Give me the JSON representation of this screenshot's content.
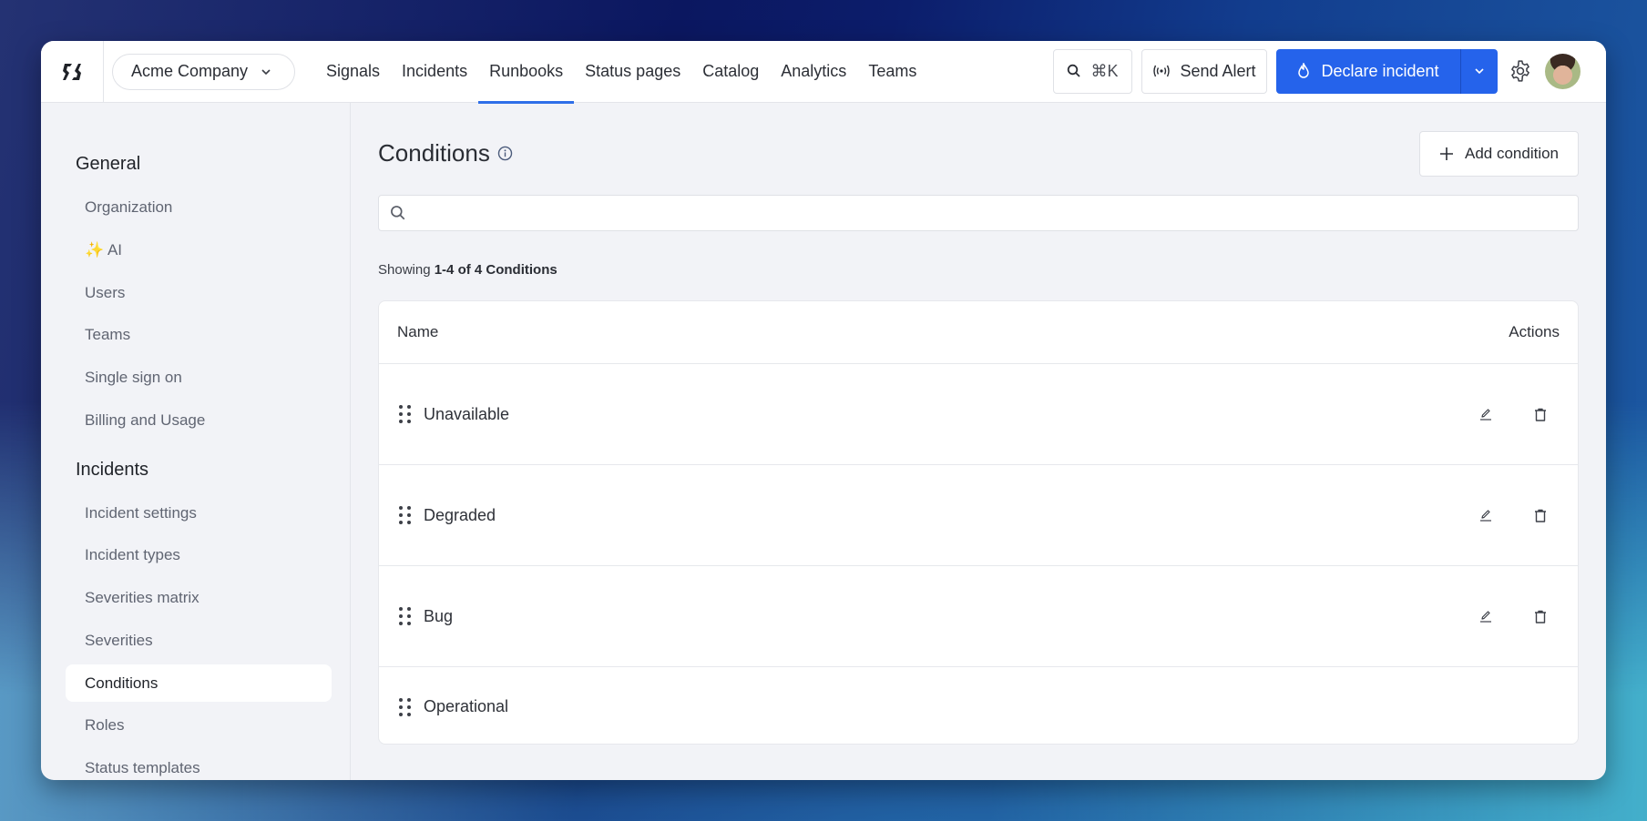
{
  "topbar": {
    "logo": "firehydrant-logo-icon",
    "org_name": "Acme Company",
    "nav": [
      {
        "label": "Signals",
        "active": false
      },
      {
        "label": "Incidents",
        "active": false
      },
      {
        "label": "Runbooks",
        "active": true
      },
      {
        "label": "Status pages",
        "active": false
      },
      {
        "label": "Catalog",
        "active": false
      },
      {
        "label": "Analytics",
        "active": false
      },
      {
        "label": "Teams",
        "active": false
      }
    ],
    "command_shortcut": "⌘K",
    "send_alert_label": "Send Alert",
    "declare_label": "Declare incident",
    "accent_color": "#2563eb"
  },
  "sidebar": {
    "sections": [
      {
        "title": "General",
        "items": [
          {
            "label": "Organization"
          },
          {
            "label": "✨ AI"
          },
          {
            "label": "Users"
          },
          {
            "label": "Teams"
          },
          {
            "label": "Single sign on"
          },
          {
            "label": "Billing and Usage"
          }
        ]
      },
      {
        "title": "Incidents",
        "items": [
          {
            "label": "Incident settings"
          },
          {
            "label": "Incident types"
          },
          {
            "label": "Severities matrix"
          },
          {
            "label": "Severities"
          },
          {
            "label": "Conditions",
            "active": true
          },
          {
            "label": "Roles"
          },
          {
            "label": "Status templates"
          }
        ]
      }
    ]
  },
  "main": {
    "title": "Conditions",
    "add_button_label": "Add condition",
    "search": {
      "value": "",
      "placeholder": ""
    },
    "showing_prefix": "Showing",
    "showing_range": "1-4 of 4 Conditions",
    "table": {
      "columns": [
        "Name",
        "Actions"
      ],
      "rows": [
        {
          "name": "Unavailable",
          "editable": true,
          "deletable": true
        },
        {
          "name": "Degraded",
          "editable": true,
          "deletable": true
        },
        {
          "name": "Bug",
          "editable": true,
          "deletable": true
        },
        {
          "name": "Operational",
          "editable": false,
          "deletable": false
        }
      ]
    }
  }
}
